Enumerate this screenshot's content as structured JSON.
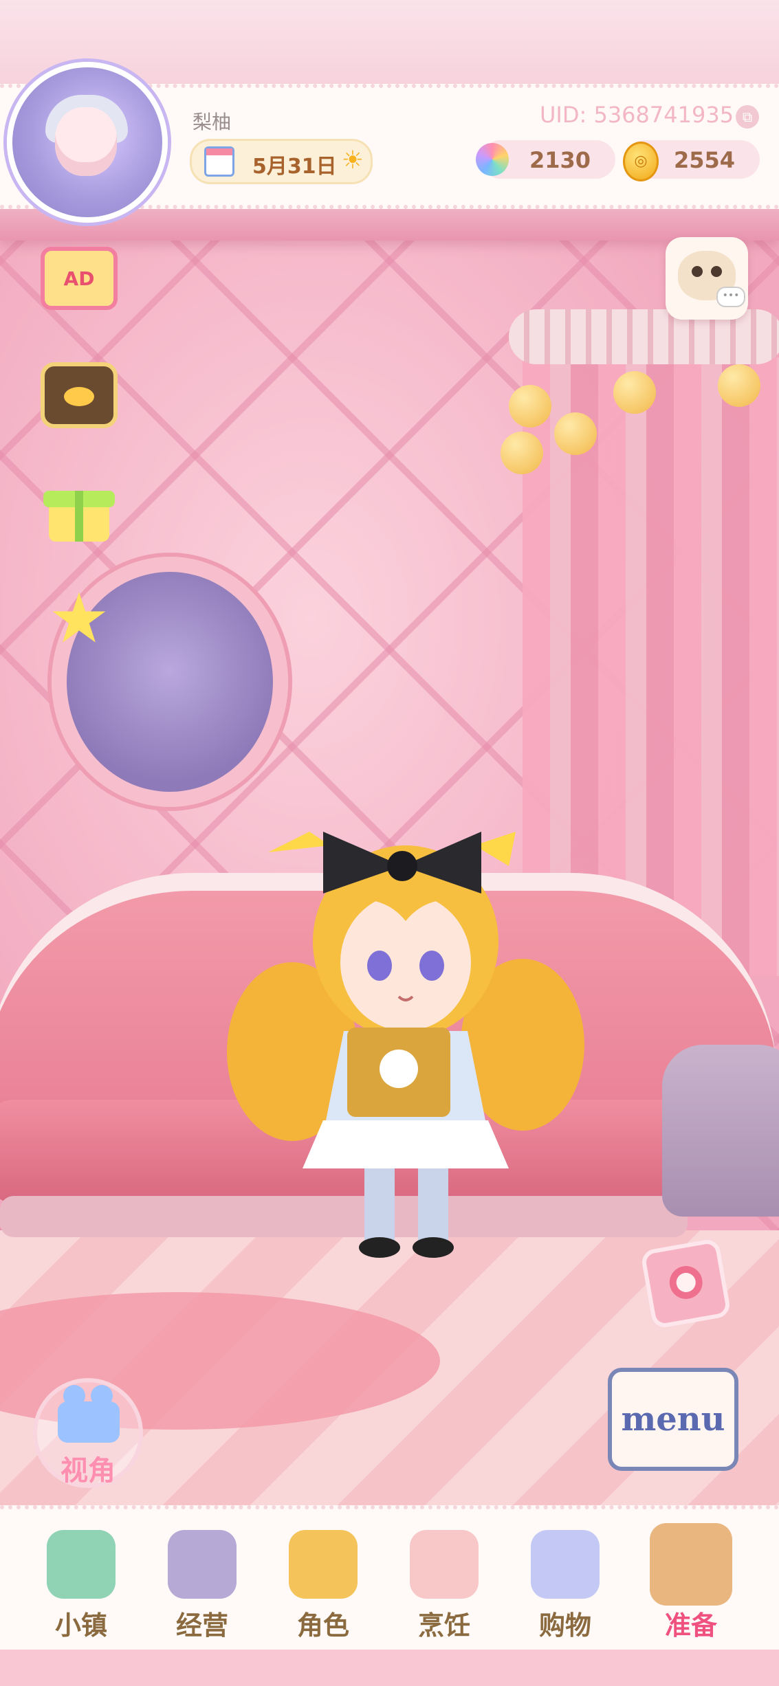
{
  "header": {
    "player_name": "梨柚",
    "date": "5月31日",
    "uid": "UID: 5368741935",
    "gems": "2130",
    "coins": "2554"
  },
  "side_buttons": {
    "ad_label": "AD"
  },
  "camera": {
    "label": "视角"
  },
  "menu": {
    "label": "menu"
  },
  "bottom_nav": {
    "items": [
      {
        "label": "小镇",
        "icon": "map-icon"
      },
      {
        "label": "经营",
        "icon": "locked-hat-icon"
      },
      {
        "label": "角色",
        "icon": "character-icon"
      },
      {
        "label": "烹饪",
        "icon": "cooking-icon"
      },
      {
        "label": "购物",
        "icon": "shopping-bag-icon"
      },
      {
        "label": "准备",
        "icon": "picnic-basket-icon"
      }
    ],
    "active": "准备"
  },
  "colors": {
    "accent_pink": "#f0527f",
    "nav_text": "#8a6a3e",
    "wall": "#f6b7c8"
  }
}
